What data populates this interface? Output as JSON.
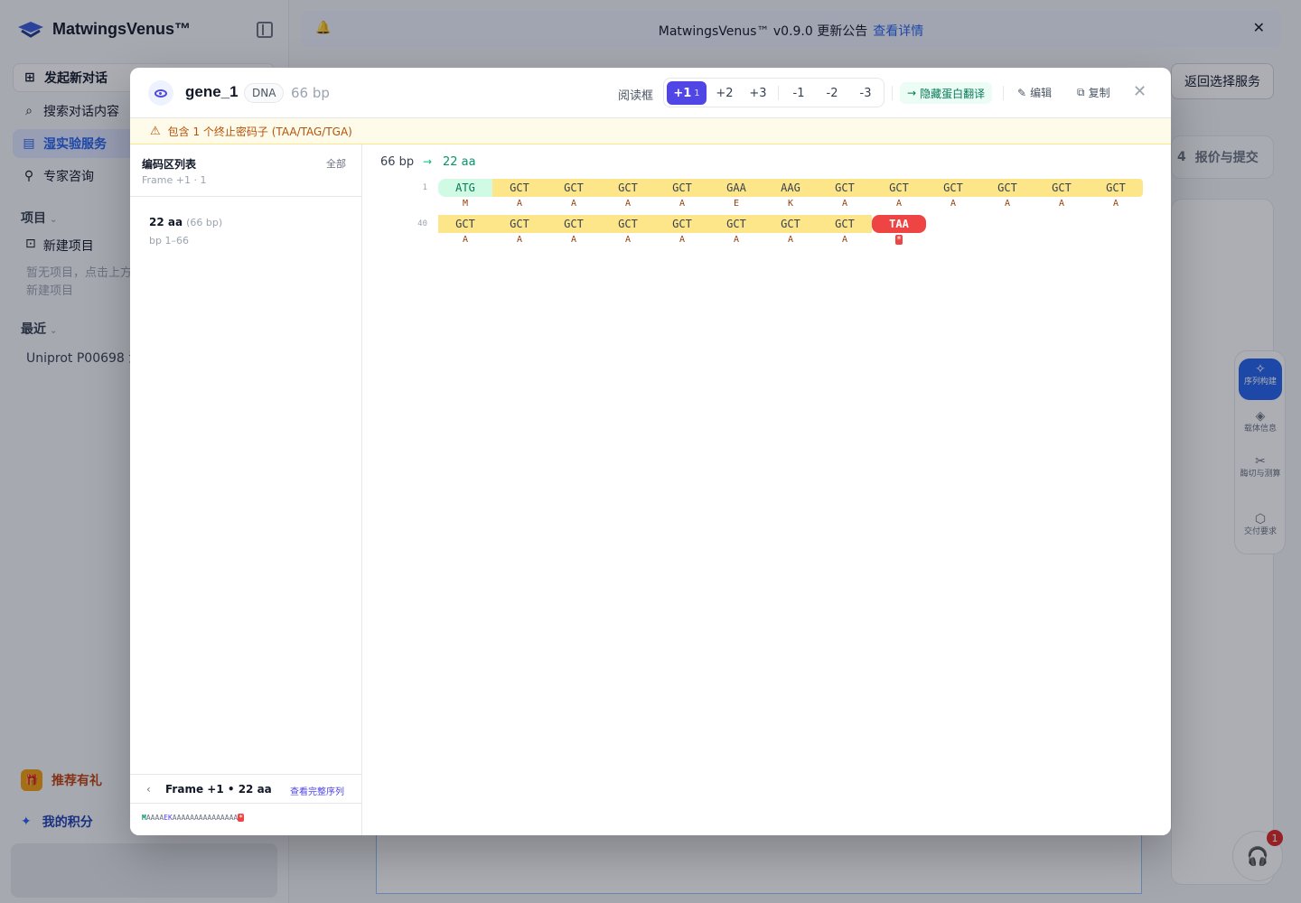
{
  "app": {
    "brand": "MatwingsVenus™",
    "nav": [
      {
        "icon": "chat-plus-icon",
        "label": "发起新对话"
      },
      {
        "icon": "search-icon",
        "label": "搜索对话内容"
      },
      {
        "icon": "lab-icon",
        "label": "湿实验服务"
      },
      {
        "icon": "expert-icon",
        "label": "专家咨询"
      }
    ],
    "projects_title": "项目",
    "new_project": "新建项目",
    "projects_empty": "暂无项目，点击上方新建项目",
    "recent_title": "最近",
    "recent_item": "Uniprot P00698 活",
    "gift_label": "推荐有礼",
    "points_label": "我的积分"
  },
  "banner": {
    "text": "MatwingsVenus™ v0.9.0 更新公告",
    "link": "查看详情"
  },
  "background": {
    "back_button": "返回选择服务",
    "step_num": "4",
    "step_label": "报价与提交",
    "rail": [
      {
        "icon": "build-icon",
        "label": "序列构建"
      },
      {
        "icon": "layers-icon",
        "label": "载体信息"
      },
      {
        "icon": "scissors-icon",
        "label": "酶切与测算"
      },
      {
        "icon": "box-icon",
        "label": "交付要求"
      }
    ],
    "support_badge": "1"
  },
  "modal": {
    "seq_name": "gene_1",
    "seq_type": "DNA",
    "length": "66 bp",
    "reading_frame_label": "阅读框",
    "frames": [
      {
        "label": "+1",
        "count": "1",
        "active": true
      },
      {
        "label": "+2",
        "count": "",
        "active": false
      },
      {
        "label": "+3",
        "count": "",
        "active": false
      },
      {
        "label": "-1",
        "count": "",
        "active": false
      },
      {
        "label": "-2",
        "count": "",
        "active": false
      },
      {
        "label": "-3",
        "count": "",
        "active": false
      }
    ],
    "hide_translation": "隐藏蛋白翻译",
    "edit": "编辑",
    "copy": "复制",
    "warning": "包含 1 个终止密码子 (TAA/TAG/TGA)",
    "orf_list": {
      "title": "编码区列表",
      "subtitle": "Frame +1 · 1",
      "all": "全部",
      "items": [
        {
          "aa": "22 aa",
          "bp": "(66 bp)",
          "range": "bp 1–66"
        }
      ]
    },
    "footer": {
      "frame_info": "Frame +1 • 22 aa",
      "view_full": "查看完整序列",
      "protein": "MAAAAEKAAAAAAAAAAAAAAA*"
    },
    "viewer": {
      "length": "66 bp",
      "aa_count": "22 aa",
      "rows": [
        {
          "start": "1",
          "codons": [
            "ATG",
            "GCT",
            "GCT",
            "GCT",
            "GCT",
            "GAA",
            "AAG",
            "GCT",
            "GCT",
            "GCT",
            "GCT",
            "GCT",
            "GCT"
          ],
          "aas": [
            "M",
            "A",
            "A",
            "A",
            "A",
            "E",
            "K",
            "A",
            "A",
            "A",
            "A",
            "A",
            "A"
          ]
        },
        {
          "start": "40",
          "codons": [
            "GCT",
            "GCT",
            "GCT",
            "GCT",
            "GCT",
            "GCT",
            "GCT",
            "GCT",
            "TAA"
          ],
          "aas": [
            "A",
            "A",
            "A",
            "A",
            "A",
            "A",
            "A",
            "A",
            "*"
          ]
        }
      ]
    }
  }
}
